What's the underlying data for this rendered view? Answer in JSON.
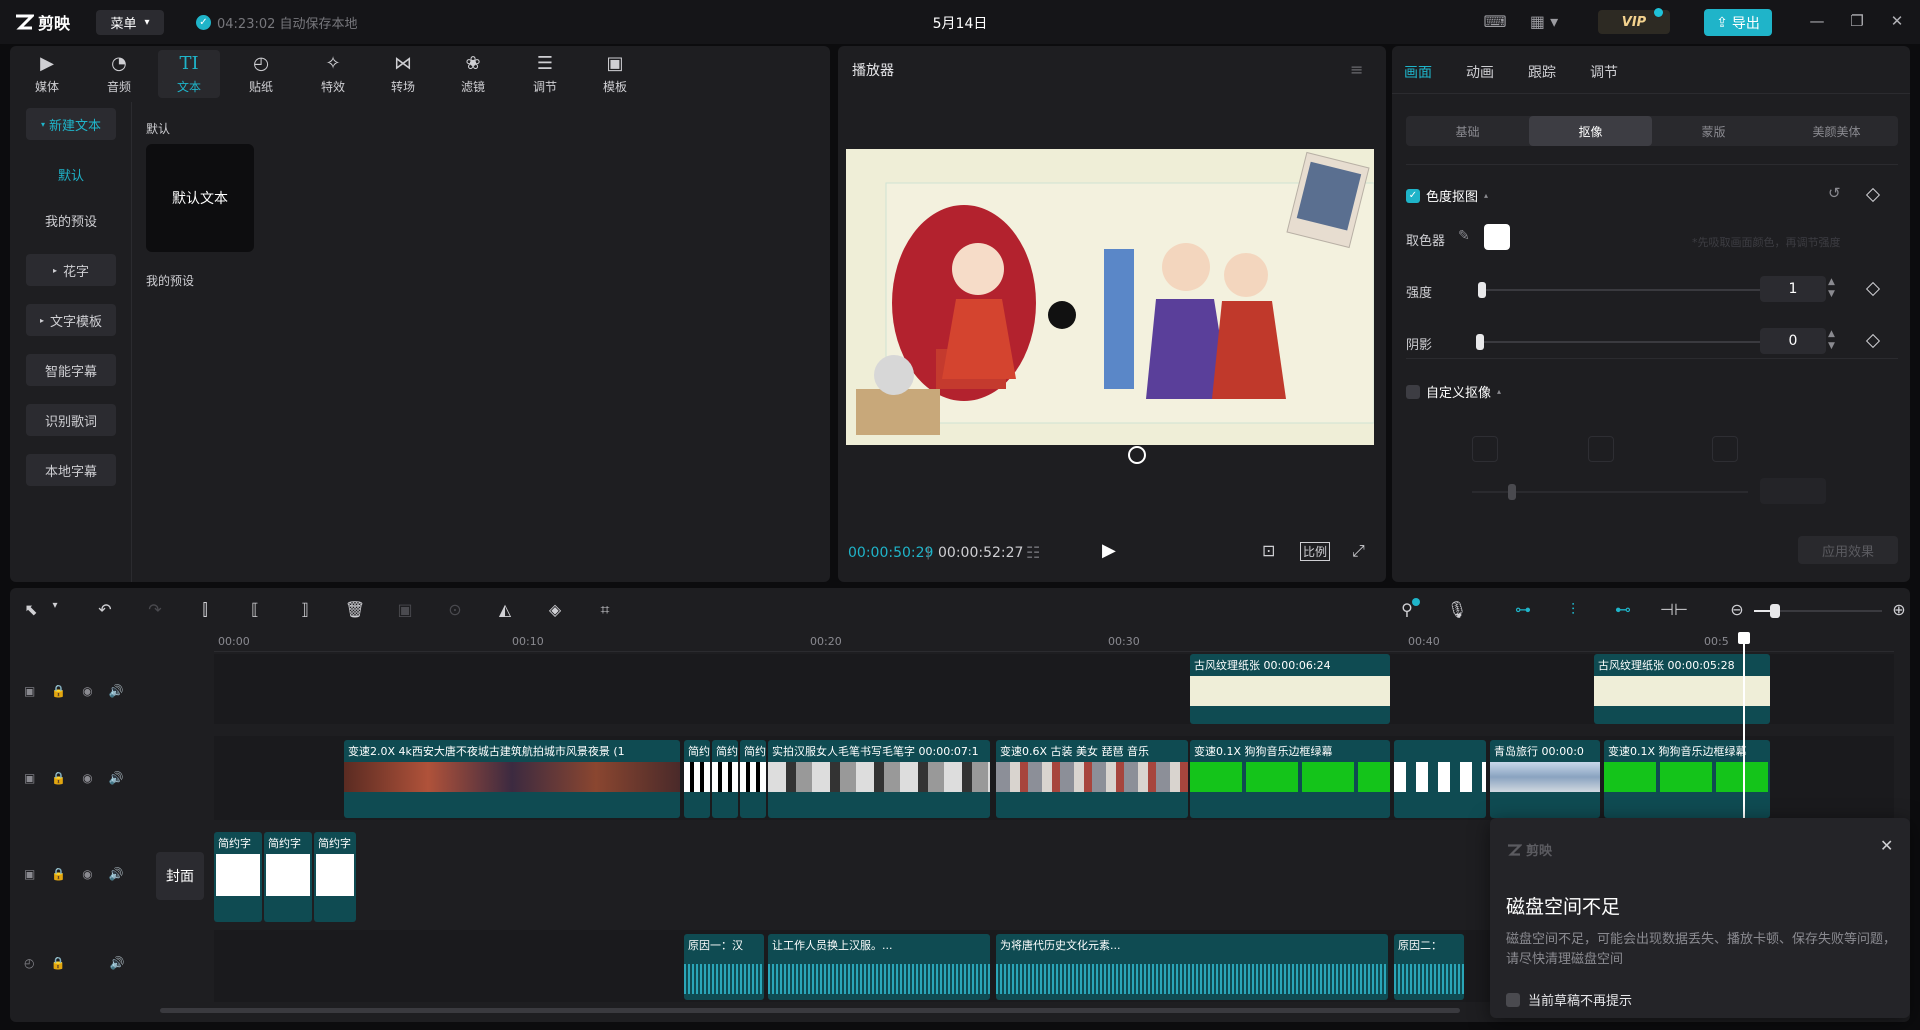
{
  "titlebar": {
    "app_name": "剪映",
    "menu_label": "菜单",
    "autosave_text": "04:23:02 自动保存本地",
    "project_title": "5月14日",
    "vip_label": "VIP",
    "export_label": "导出"
  },
  "media_tabs": [
    {
      "label": "媒体",
      "icon": "media-icon"
    },
    {
      "label": "音频",
      "icon": "audio-icon"
    },
    {
      "label": "文本",
      "icon": "text-icon",
      "active": true
    },
    {
      "label": "贴纸",
      "icon": "sticker-icon"
    },
    {
      "label": "特效",
      "icon": "effects-icon"
    },
    {
      "label": "转场",
      "icon": "transition-icon"
    },
    {
      "label": "滤镜",
      "icon": "filter-icon"
    },
    {
      "label": "调节",
      "icon": "adjust-icon"
    },
    {
      "label": "模板",
      "icon": "template-icon"
    }
  ],
  "text_sidebar": {
    "new_text": "新建文本",
    "default": "默认",
    "my_presets": "我的预设",
    "fancy_text": "花字",
    "text_template": "文字模板",
    "smart_subtitle": "智能字幕",
    "lyrics": "识别歌词",
    "local_subtitle": "本地字幕"
  },
  "text_content": {
    "default_section": "默认",
    "default_card": "默认文本",
    "presets_section": "我的预设"
  },
  "player": {
    "title": "播放器",
    "current_time": "00:00:50:29",
    "total_time": "00:00:52:27",
    "ratio_label": "比例"
  },
  "props": {
    "tabs": [
      "画面",
      "动画",
      "跟踪",
      "调节"
    ],
    "segments": [
      "基础",
      "抠像",
      "蒙版",
      "美颜美体"
    ],
    "chroma_key": "色度抠图",
    "color_picker": "取色器",
    "strength_label": "强度",
    "strength_value": "1",
    "shadow_label": "阴影",
    "shadow_value": "0",
    "custom_key": "自定义抠像",
    "hint": "*先吸取画面颜色，再调节强度",
    "apply_label": "应用效果"
  },
  "timeline": {
    "ticks": [
      "00:00",
      "00:10",
      "00:20",
      "00:30",
      "00:40",
      "00:5"
    ],
    "cover_label": "封面",
    "overlay_clips": [
      {
        "label": "古风纹理纸张  00:00:06:24"
      },
      {
        "label": "古风纹理纸张  00:00:05:28"
      }
    ],
    "main_clips": [
      {
        "label": "变速2.0X   4k西安大唐不夜城古建筑航拍城市风景夜景 (1"
      },
      {
        "label": "简约"
      },
      {
        "label": "简约"
      },
      {
        "label": "简约"
      },
      {
        "label": "实拍汉服女人毛笔书写毛笔字  00:00:07:1"
      },
      {
        "label": "变速0.6X   古装 美女 琵琶 音乐"
      },
      {
        "label": "变速0.1X   狗狗音乐边框绿幕"
      },
      {
        "label": "青岛旅行  00:00:0"
      },
      {
        "label": "变速0.1X   狗狗音乐边框绿幕"
      }
    ],
    "text_clips": [
      {
        "label": "简约字"
      },
      {
        "label": "简约字"
      },
      {
        "label": "简约字"
      }
    ],
    "audio_clips": [
      {
        "label": "原因一：汉"
      },
      {
        "label": "让工作人员换上汉服。..."
      },
      {
        "label": "为将唐代历史文化元素..."
      },
      {
        "label": "原因二："
      }
    ]
  },
  "toast": {
    "brand": "剪映",
    "title": "磁盘空间不足",
    "body": "磁盘空间不足，可能会出现数据丢失、播放卡顿、保存失败等问题，请尽快清理磁盘空间",
    "dont_show": "当前草稿不再提示"
  },
  "colors": {
    "accent": "#1fb4c9",
    "clip": "#0f4b52",
    "green_screen": "#14c41a"
  }
}
